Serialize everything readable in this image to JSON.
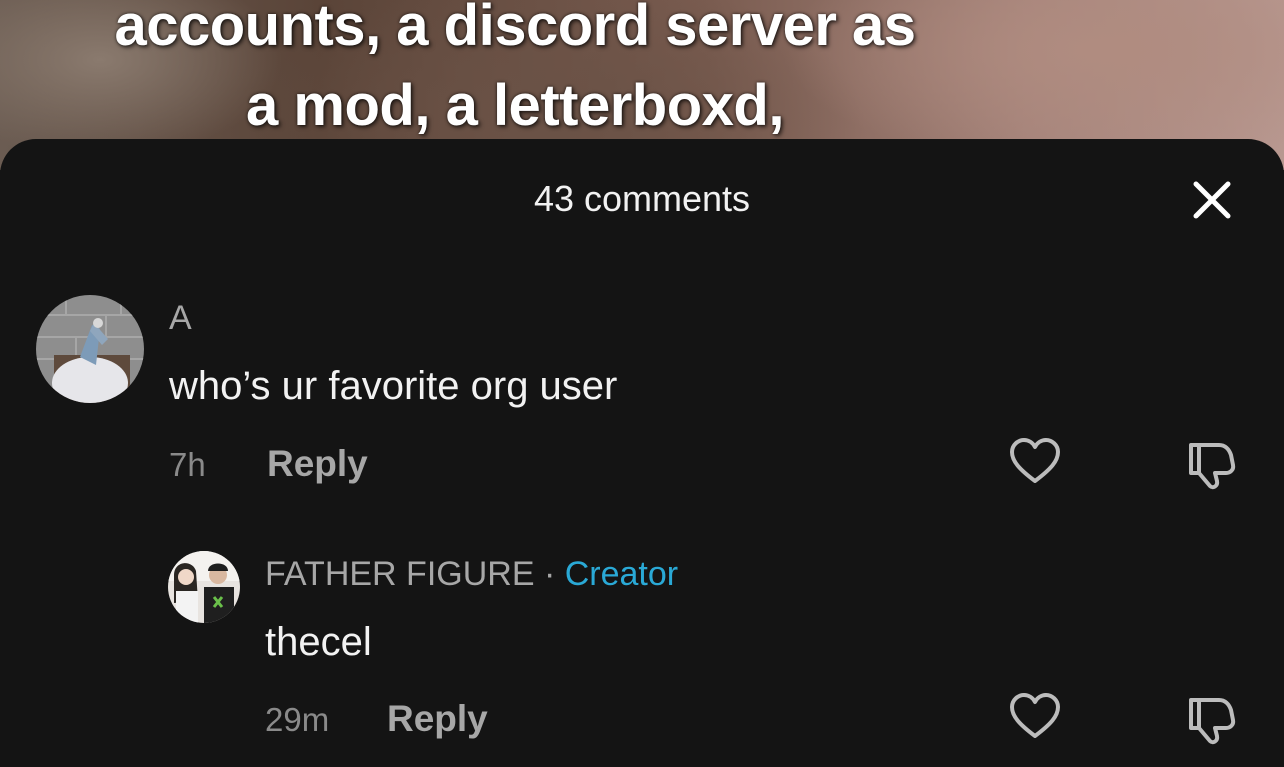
{
  "video": {
    "caption_line1": "accounts, a discord server as",
    "caption_line2": "a mod, a letterboxd,"
  },
  "sheet": {
    "title": "43 comments",
    "close_icon": "close-icon"
  },
  "comments": [
    {
      "username": "A",
      "text": "who’s ur favorite org user",
      "time": "7h",
      "reply_label": "Reply",
      "like_icon": "heart-icon",
      "dislike_icon": "thumbs-down-icon"
    }
  ],
  "replies": [
    {
      "username": "FATHER FIGURE",
      "separator": " · ",
      "badge": "Creator",
      "text": "thecel",
      "time": "29m",
      "reply_label": "Reply",
      "like_icon": "heart-icon",
      "dislike_icon": "thumbs-down-icon"
    }
  ],
  "colors": {
    "sheet_background": "#141414",
    "creator_badge": "#2aa9d6"
  }
}
